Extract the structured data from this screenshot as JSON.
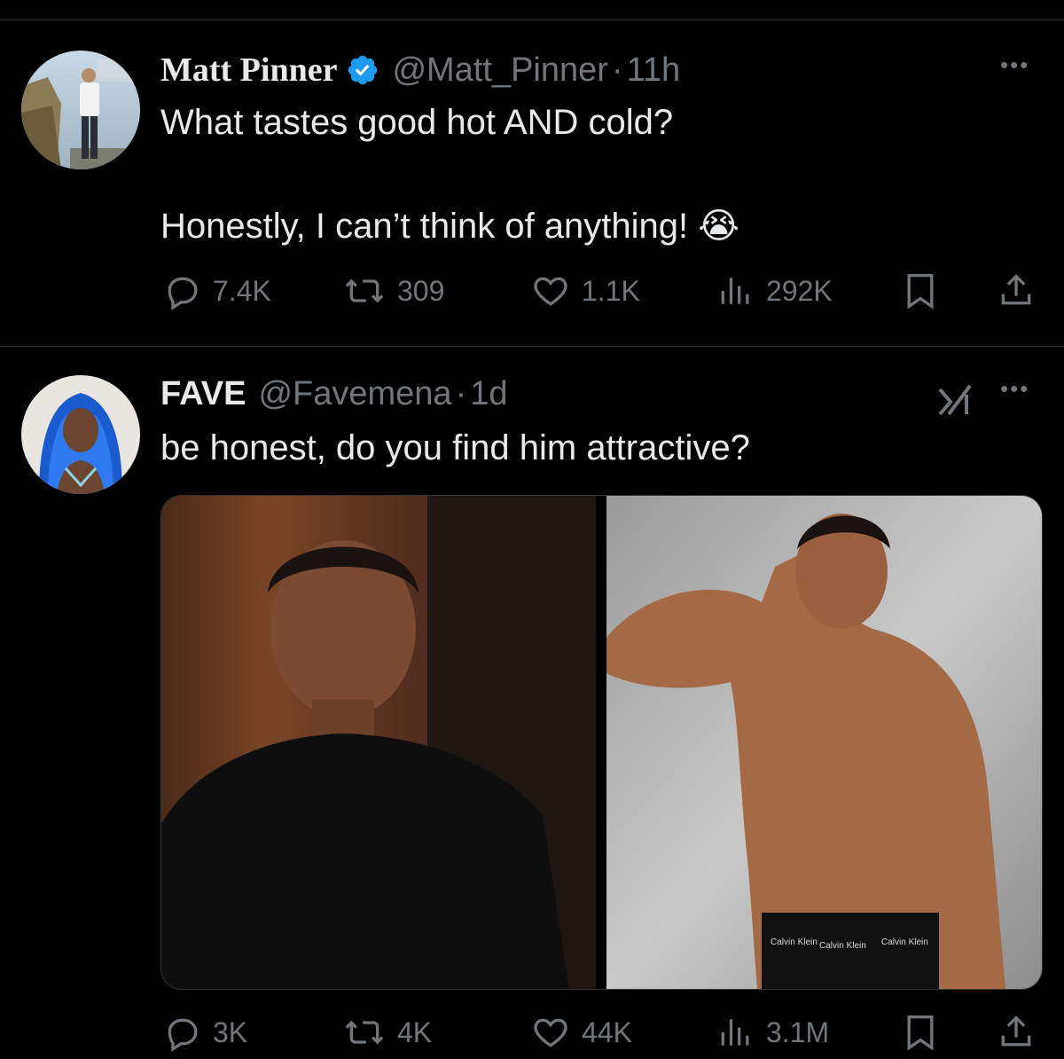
{
  "tweets": [
    {
      "author_name": "Matt Pinner",
      "verified": true,
      "handle": "@Matt_Pinner",
      "separator": "·",
      "time": "11h",
      "text_line1": "What tastes good hot AND cold?",
      "text_line2": "Honestly, I can’t think of anything! 😭",
      "metrics": {
        "replies": "7.4K",
        "reposts": "309",
        "likes": "1.1K",
        "views": "292K"
      },
      "more_label": "•••"
    },
    {
      "author_name": "FAVE",
      "verified": false,
      "handle": "@Favemena",
      "separator": "·",
      "time": "1d",
      "text_line1": "be honest, do you find him attractive?",
      "grok_icon": "grok-icon",
      "media_captions": [
        "Calvin Klein",
        "Calvin Klein",
        "Calvin Klein"
      ],
      "metrics": {
        "replies": "3K",
        "reposts": "4K",
        "likes": "44K",
        "views": "3.1M"
      },
      "more_label": "•••"
    }
  ],
  "colors": {
    "background": "#000000",
    "text": "#e7e9ea",
    "muted": "#71767b",
    "verified": "#1d9bf0",
    "divider": "#2f3336"
  }
}
